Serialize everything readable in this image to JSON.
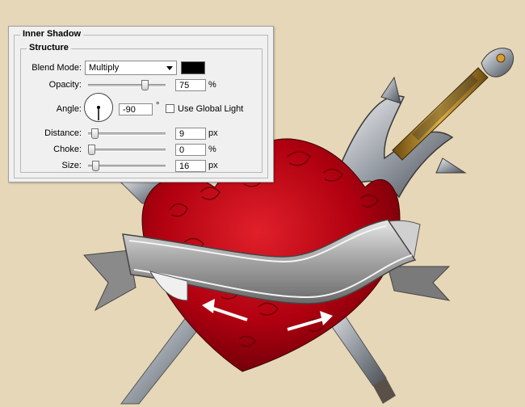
{
  "panel": {
    "section_title": "Inner Shadow",
    "group_title": "Structure",
    "blend_mode": {
      "label": "Blend Mode:",
      "value": "Multiply",
      "color": "#000000"
    },
    "opacity": {
      "label": "Opacity:",
      "value": "75",
      "unit": "%",
      "level": 0.75
    },
    "angle": {
      "label": "Angle:",
      "value": "-90",
      "unit": "°",
      "degrees": -90
    },
    "global_light": {
      "label": "Use Global Light",
      "checked": false
    },
    "distance": {
      "label": "Distance:",
      "value": "9",
      "unit": "px",
      "level": 0.04
    },
    "choke": {
      "label": "Choke:",
      "value": "0",
      "unit": "%",
      "level": 0.0
    },
    "size": {
      "label": "Size:",
      "value": "16",
      "unit": "px",
      "level": 0.06
    }
  },
  "colors": {
    "background": "#e6d7b8",
    "rose_red": "#b00010",
    "ribbon": "#9a9a9a",
    "arrow": "#ffffff"
  }
}
